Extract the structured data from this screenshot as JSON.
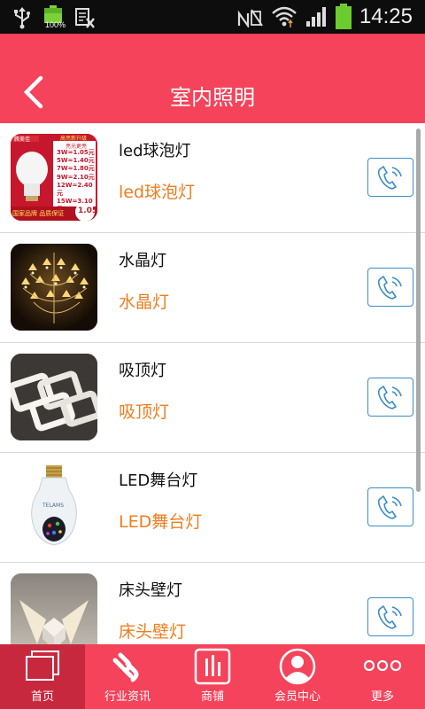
{
  "status_bar": {
    "time": "14:25",
    "battery_percent": "100%"
  },
  "header": {
    "title": "室内照明",
    "back_icon": "chevron-left-icon"
  },
  "products": [
    {
      "name": "led球泡灯",
      "subtitle": "led球泡灯",
      "image": "led-bulb-image",
      "action_icon": "phone-call-icon",
      "price_lines": [
        "3W=1.05元",
        "5W=1.40元",
        "7W=1.80元",
        "9W=2.10元",
        "12W=2.40元",
        "15W=3.10元"
      ],
      "badge_top": "腾美佳",
      "badge_top2": "高亮新升级",
      "badge_top3": "亮光更亮",
      "badge_bottom": "国家品牌 品质保证",
      "badge_price": "1.05"
    },
    {
      "name": "水晶灯",
      "subtitle": "水晶灯",
      "image": "crystal-chandelier-image",
      "action_icon": "phone-call-icon"
    },
    {
      "name": "吸顶灯",
      "subtitle": "吸顶灯",
      "image": "ceiling-lamp-image",
      "action_icon": "phone-call-icon"
    },
    {
      "name": "LED舞台灯",
      "subtitle": "LED舞台灯",
      "image": "led-stage-bulb-image",
      "action_icon": "phone-call-icon",
      "bulb_brand": "TELAMS"
    },
    {
      "name": "床头壁灯",
      "subtitle": "床头壁灯",
      "image": "wall-lamp-image",
      "action_icon": "phone-call-icon"
    }
  ],
  "tabs": [
    {
      "label": "首页",
      "icon": "home-windows-icon",
      "active": true
    },
    {
      "label": "行业资讯",
      "icon": "link-chain-icon",
      "active": false
    },
    {
      "label": "商铺",
      "icon": "bar-chart-icon",
      "active": false
    },
    {
      "label": "会员中心",
      "icon": "user-profile-icon",
      "active": false
    },
    {
      "label": "更多",
      "icon": "more-dots-icon",
      "active": false
    }
  ],
  "colors": {
    "header_red": "#f4435a",
    "active_tab": "#c8283d",
    "subtitle_orange": "#ef7d1f",
    "call_border": "#3a8dc6"
  }
}
